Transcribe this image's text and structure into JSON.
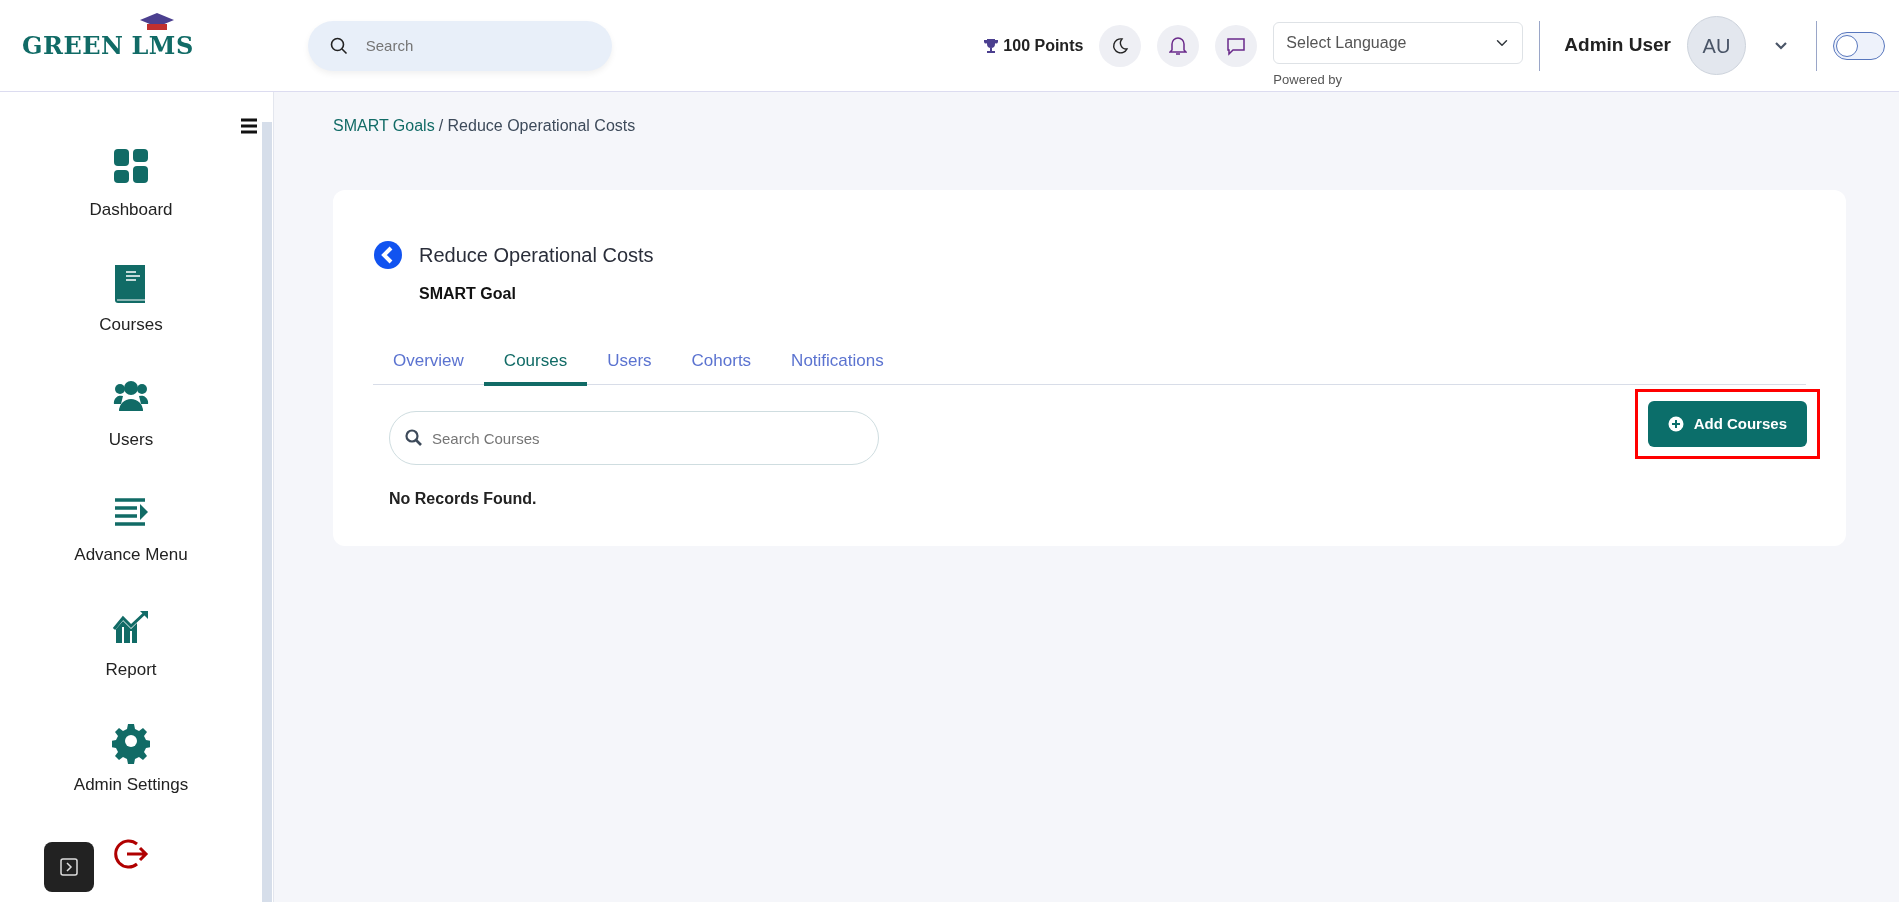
{
  "header": {
    "logo": {
      "word_1": "GREEN",
      "word_2": "LMS"
    },
    "search": {
      "placeholder": "Search"
    },
    "points": "100 Points",
    "language": {
      "value": "Select Language",
      "note": "Powered by"
    },
    "user": {
      "name": "Admin User",
      "initials": "AU"
    },
    "theme_toggle": {
      "on": false
    }
  },
  "sidebar": {
    "items": [
      {
        "label": "Dashboard"
      },
      {
        "label": "Courses"
      },
      {
        "label": "Users"
      },
      {
        "label": "Advance Menu"
      },
      {
        "label": "Report"
      },
      {
        "label": "Admin Settings"
      }
    ]
  },
  "breadcrumb": [
    {
      "label": "SMART Goals",
      "kind": "link"
    },
    {
      "label": "/ Reduce Operational Costs",
      "kind": "current"
    }
  ],
  "goal": {
    "title": "Reduce Operational Costs",
    "subtitle": "SMART Goal"
  },
  "tabs": [
    {
      "label": "Overview",
      "selected": false
    },
    {
      "label": "Courses",
      "selected": true
    },
    {
      "label": "Users",
      "selected": false
    },
    {
      "label": "Cohorts",
      "selected": false
    },
    {
      "label": "Notifications",
      "selected": false
    }
  ],
  "courses": {
    "search": {
      "placeholder": "Search Courses"
    },
    "add_button": {
      "label": "Add Courses",
      "highlighted": true
    },
    "empty_text": "No Records Found."
  }
}
